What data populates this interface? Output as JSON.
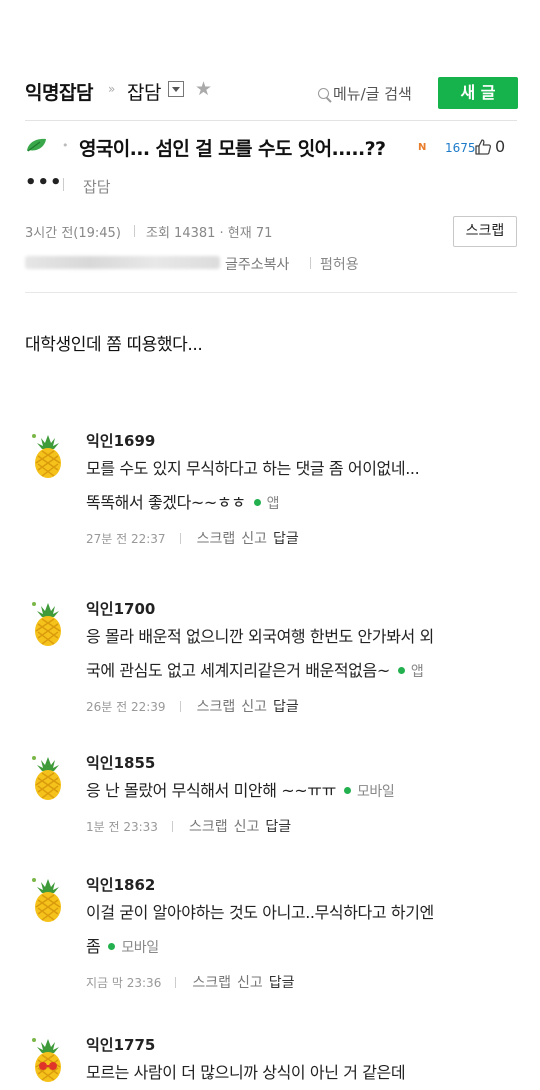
{
  "header": {
    "board_name": "익명잡담",
    "separator": "»",
    "subboard": "잡담",
    "star": "★",
    "search_label": "메뉴/글 검색",
    "new_post_label": "새 글"
  },
  "post": {
    "title": "영국이... 섬인 걸 모를 수도 잇어.....??",
    "new_badge": "N",
    "view_count_badge": "1675",
    "like_count": "0",
    "more_label": "•••",
    "category": "잡담",
    "time": "3시간 전(19:45)",
    "views": "조회 14381 · 현재 71",
    "scrap_label": "스크랩",
    "copy_url_label": "글주소복사",
    "allow_share_label": "펌허용",
    "body": "대학생인데 쫌 띠용했다..."
  },
  "comments": [
    {
      "author": "익인1699",
      "lines": [
        "모를 수도 있지 무식하다고 하는 댓글 좀 어이없네...",
        "똑똑해서 좋겠다~~ㅎㅎ"
      ],
      "source": "앱",
      "time": "27분 전 22:37",
      "scrap": "스크랩",
      "report": "신고",
      "reply": "답글"
    },
    {
      "author": "익인1700",
      "lines": [
        "응 몰라 배운적 없으니깐 외국여행 한번도 안가봐서 외",
        "국에 관심도 없고 세계지리같은거 배운적없음~"
      ],
      "source": "앱",
      "time": "26분 전 22:39",
      "scrap": "스크랩",
      "report": "신고",
      "reply": "답글"
    },
    {
      "author": "익인1855",
      "lines": [
        "응 난 몰랐어 무식해서 미안해 ~~ㅠㅠ"
      ],
      "source": "모바일",
      "time": "1분 전 23:33",
      "scrap": "스크랩",
      "report": "신고",
      "reply": "답글"
    },
    {
      "author": "익인1862",
      "lines": [
        "이걸 굳이 알아야하는 것도 아니고..무식하다고 하기엔",
        "좀"
      ],
      "source": "모바일",
      "time": "지금 막 23:36",
      "scrap": "스크랩",
      "report": "신고",
      "reply": "답글"
    },
    {
      "author": "익인1775",
      "lines": [
        "모르는 사람이 더 많으니까 상식이 아닌 거 같은데"
      ],
      "source": "",
      "time": "",
      "scrap": "",
      "report": "",
      "reply": ""
    }
  ],
  "colors": {
    "accent_green": "#16b24b",
    "source_dot": "#23b04e",
    "view_badge_blue": "#1e7bc9",
    "new_badge_orange": "#e87d2c"
  },
  "icons": {
    "leaf": "leaf-icon",
    "like": "thumbs-up-icon",
    "search": "search-icon",
    "avatar": "pineapple-avatar-icon"
  }
}
